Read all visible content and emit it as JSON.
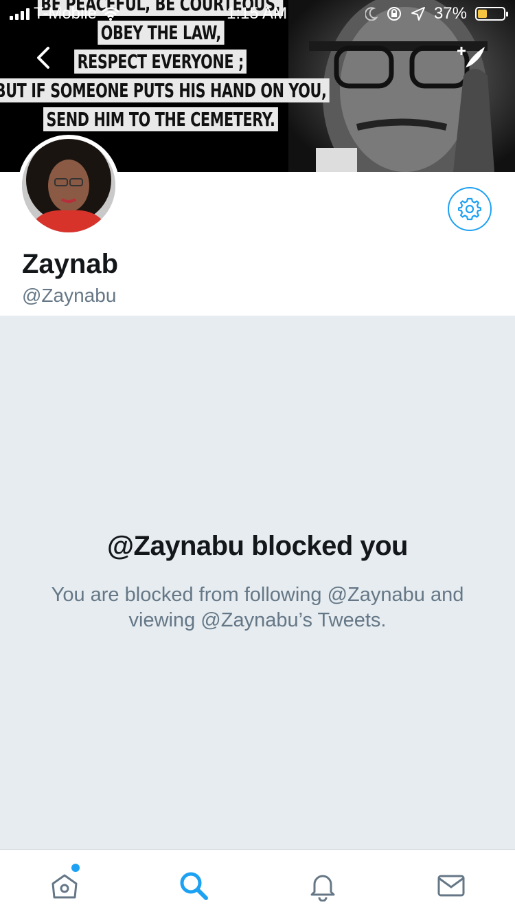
{
  "status_bar": {
    "carrier": "T-Mobile",
    "time": "1:15 AM",
    "battery": "37%",
    "battery_level": 0.37
  },
  "header": {
    "quote_lines": [
      "BE PEACEFUL, BE COURTEOUS,",
      "OBEY THE LAW,",
      "RESPECT EVERYONE ;",
      "BUT IF SOMEONE PUTS HIS HAND ON YOU,",
      "SEND HIM TO THE CEMETERY."
    ],
    "back_icon": "chevron-left-icon",
    "compose_icon": "feather-plus-icon"
  },
  "profile": {
    "name": "Zaynab",
    "handle": "@Zaynabu",
    "settings_icon": "gear-icon"
  },
  "blocked": {
    "title": "@Zaynabu blocked you",
    "message": "You are blocked from following @Zaynabu and viewing @Zaynabu’s Tweets."
  },
  "tabbar": {
    "items": [
      {
        "icon": "home-icon",
        "active": false,
        "has_dot": true
      },
      {
        "icon": "search-icon",
        "active": true,
        "has_dot": false
      },
      {
        "icon": "bell-icon",
        "active": false,
        "has_dot": false
      },
      {
        "icon": "mail-icon",
        "active": false,
        "has_dot": false
      }
    ]
  },
  "colors": {
    "accent": "#1da1f2",
    "muted": "#657786",
    "background_gray": "#e6ecf0",
    "text_dark": "#14171a"
  }
}
